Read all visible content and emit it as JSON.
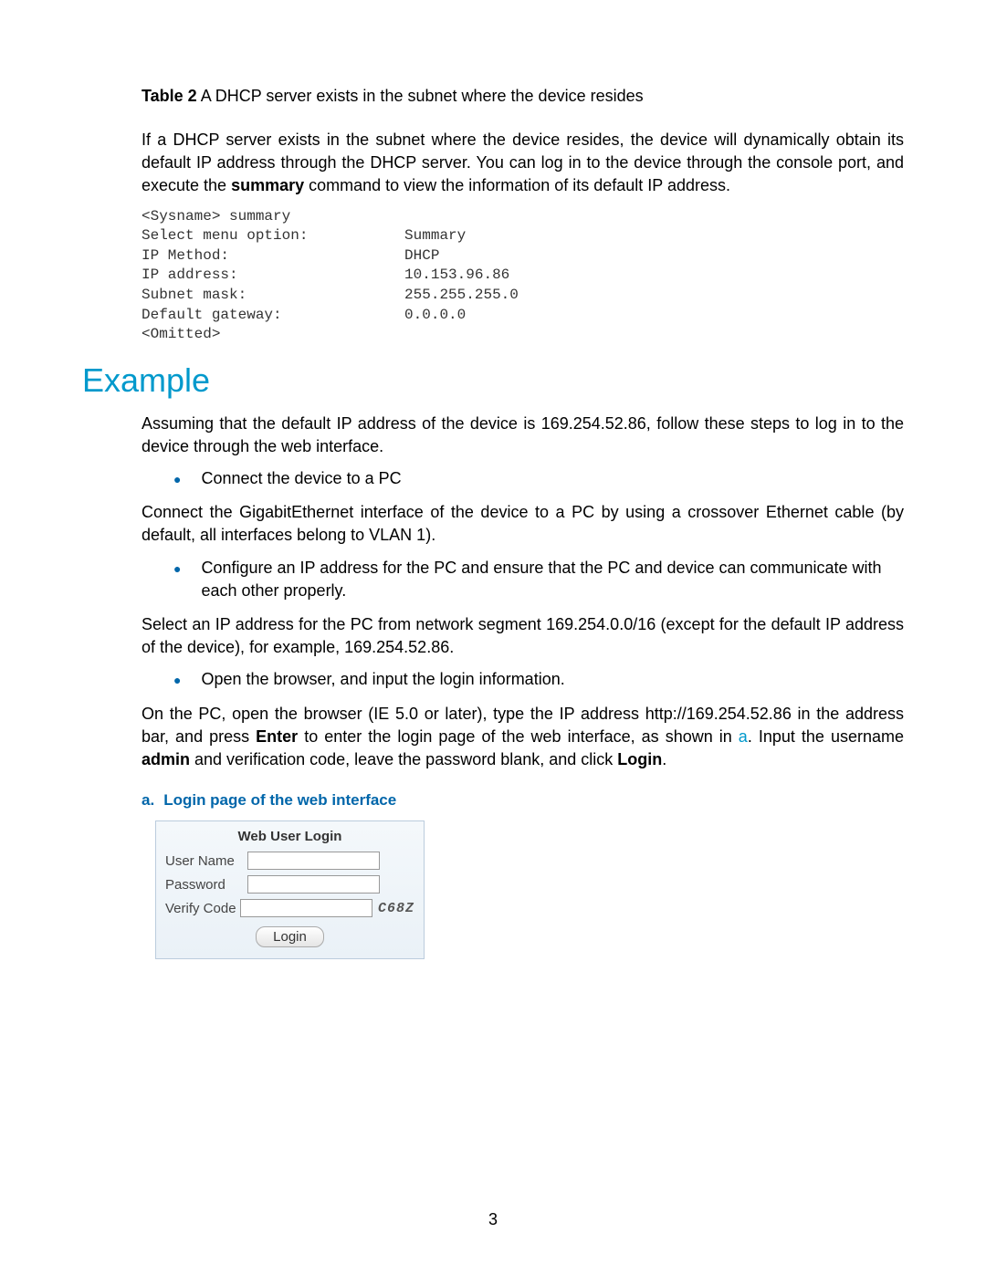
{
  "tableCaption": {
    "label": "Table 2",
    "text": " A DHCP server exists in the subnet where the device resides"
  },
  "intro": {
    "part1": "If a DHCP server exists in the subnet where the device resides, the device will dynamically obtain its default IP address through the DHCP server. You can log in to the device through the console port, and execute the ",
    "bold": "summary",
    "part2": " command to view the information of its default IP address."
  },
  "console": "<Sysname> summary\nSelect menu option:           Summary\nIP Method:                    DHCP\nIP address:                   10.153.96.86\nSubnet mask:                  255.255.255.0\nDefault gateway:              0.0.0.0\n<Omitted>",
  "exampleHeading": "Example",
  "examplePara1": "Assuming that the default IP address of the device is 169.254.52.86, follow these steps to log in to the device through the web interface.",
  "bullet1": "Connect the device to a PC",
  "para2": "Connect the GigabitEthernet interface of the device to a PC by using a crossover Ethernet cable (by default, all interfaces belong to VLAN 1).",
  "bullet2": "Configure an IP address for the PC and ensure that the PC and device can communicate with each other properly.",
  "para3": "Select an IP address for the PC from network segment 169.254.0.0/16 (except for the default IP address of the device), for example, 169.254.52.86.",
  "bullet3": "Open the browser, and input the login information.",
  "para4": {
    "p1": "On the PC, open the browser (IE 5.0 or later), type the IP address http://169.254.52.86 in the address bar, and press ",
    "b1": "Enter",
    "p2": " to enter the login page of the web interface, as shown in ",
    "link": "a",
    "p3": ". Input the username ",
    "b2": "admin",
    "p4": " and verification code, leave the password blank, and click ",
    "b3": "Login",
    "p5": "."
  },
  "figureCaption": {
    "label": "a.",
    "text": "Login page of the web interface"
  },
  "loginBox": {
    "title": "Web User Login",
    "userNameLabel": "User Name",
    "passwordLabel": "Password",
    "verifyLabel": "Verify Code",
    "verifyCode": "C68Z",
    "loginBtn": "Login"
  },
  "pageNumber": "3"
}
